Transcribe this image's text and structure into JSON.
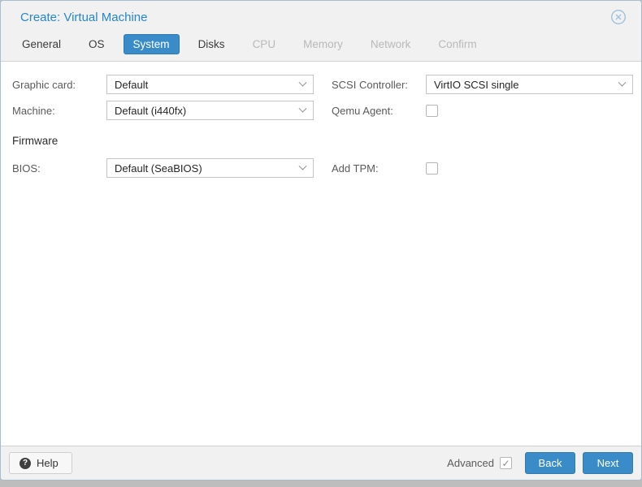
{
  "dialog": {
    "title": "Create: Virtual Machine"
  },
  "tabs": [
    {
      "label": "General",
      "state": "enabled"
    },
    {
      "label": "OS",
      "state": "enabled"
    },
    {
      "label": "System",
      "state": "active"
    },
    {
      "label": "Disks",
      "state": "enabled"
    },
    {
      "label": "CPU",
      "state": "disabled"
    },
    {
      "label": "Memory",
      "state": "disabled"
    },
    {
      "label": "Network",
      "state": "disabled"
    },
    {
      "label": "Confirm",
      "state": "disabled"
    }
  ],
  "form": {
    "rows": [
      {
        "left": {
          "label": "Graphic card:",
          "type": "select",
          "value": "Default"
        },
        "right": {
          "label": "SCSI Controller:",
          "type": "select",
          "value": "VirtIO SCSI single"
        }
      },
      {
        "left": {
          "label": "Machine:",
          "type": "select",
          "value": "Default (i440fx)"
        },
        "right": {
          "label": "Qemu Agent:",
          "type": "checkbox",
          "state": "unchecked"
        }
      },
      {
        "left": {
          "label": "Firmware",
          "type": "section"
        }
      },
      {
        "left": {
          "label": "BIOS:",
          "type": "select",
          "value": "Default (SeaBIOS)"
        },
        "right": {
          "label": "Add TPM:",
          "type": "checkbox",
          "state": "unchecked"
        }
      }
    ]
  },
  "footer": {
    "help_label": "Help",
    "advanced_label": "Advanced",
    "advanced_state": "checked",
    "back_label": "Back",
    "next_label": "Next"
  },
  "icons": {
    "close": "circle-x-icon",
    "help": "question-circle-icon",
    "dropdown": "chevron-down-icon",
    "help_glyph": "?"
  },
  "colors": {
    "title_blue": "#2787c9",
    "accent_blue": "#3a8cc8",
    "panel_gray": "#f1f1f1",
    "border_gray": "#d2d2d2",
    "disabled_text": "#b9b9b9"
  }
}
